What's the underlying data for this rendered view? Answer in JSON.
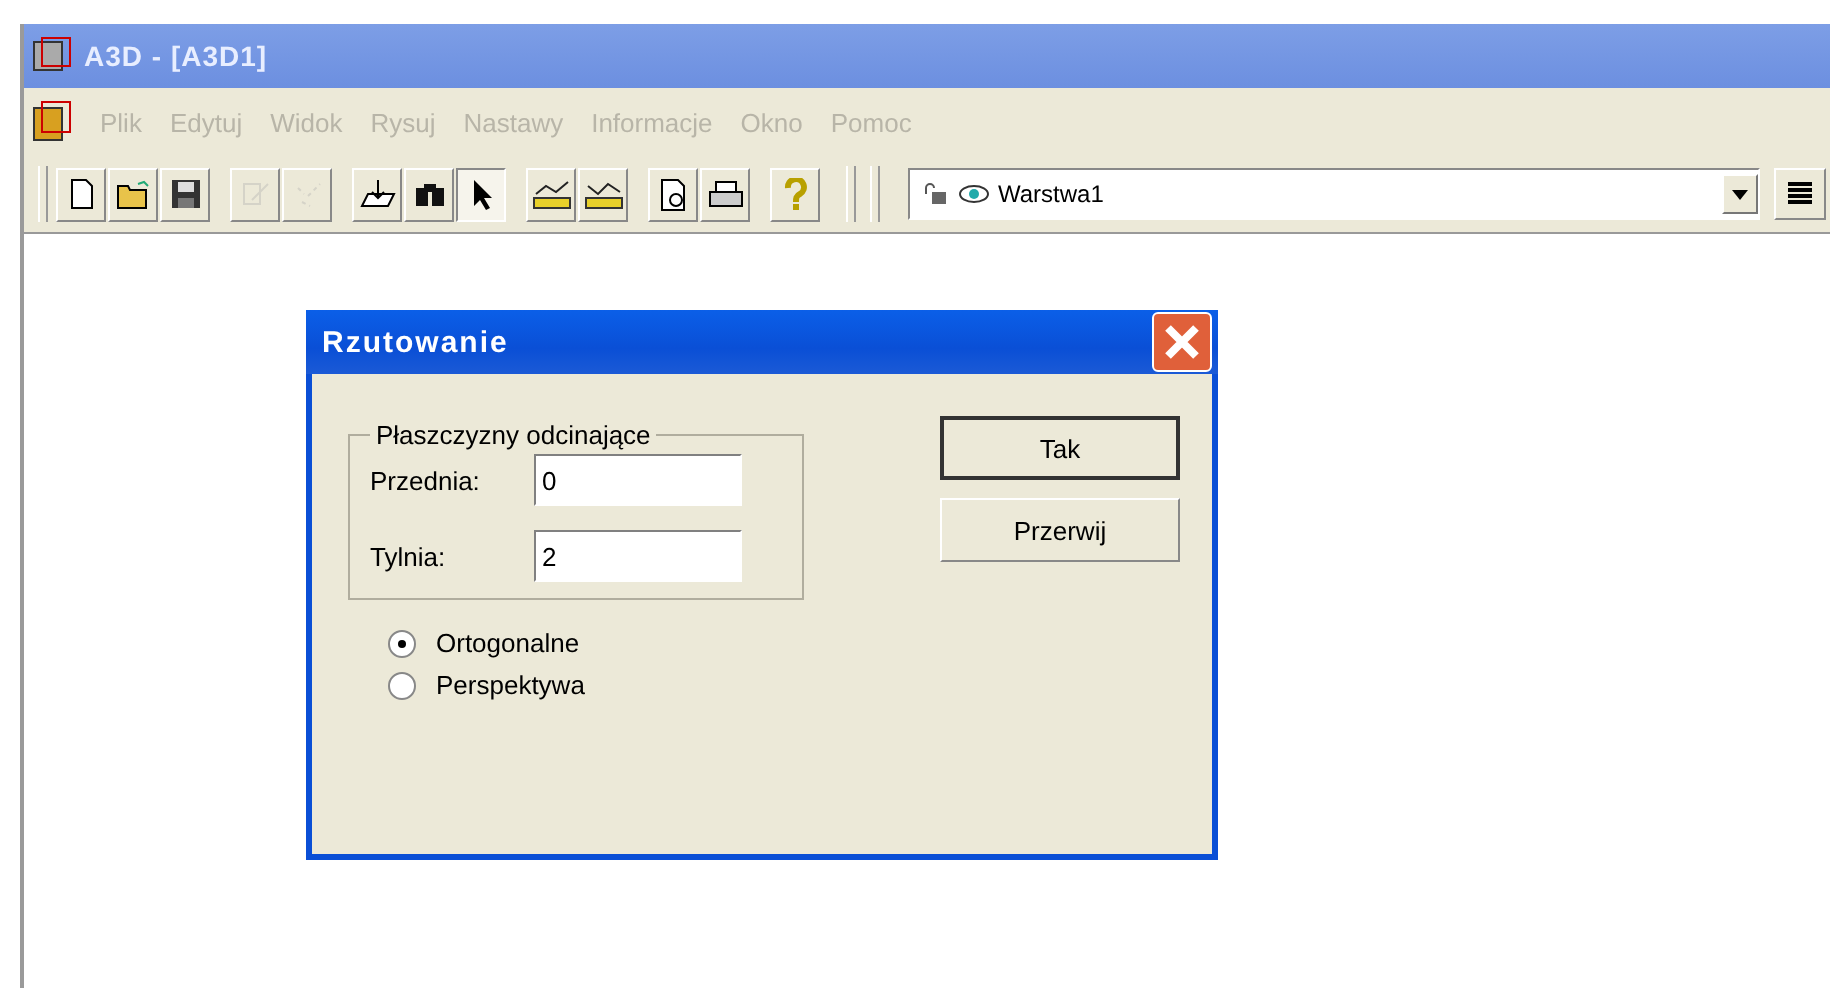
{
  "window": {
    "title": "A3D - [A3D1]"
  },
  "menu": [
    {
      "label": "Plik",
      "disabled": true
    },
    {
      "label": "Edytuj",
      "disabled": true
    },
    {
      "label": "Widok",
      "disabled": true
    },
    {
      "label": "Rysuj",
      "disabled": true
    },
    {
      "label": "Nastawy",
      "disabled": true
    },
    {
      "label": "Informacje",
      "disabled": true
    },
    {
      "label": "Okno",
      "disabled": true
    },
    {
      "label": "Pomoc",
      "disabled": true
    }
  ],
  "toolbar": [
    {
      "kind": "new",
      "disabled": false,
      "pressed": false
    },
    {
      "kind": "open",
      "disabled": false,
      "pressed": false
    },
    {
      "kind": "save",
      "disabled": false,
      "pressed": false
    },
    {
      "kind": "edit",
      "disabled": true,
      "pressed": false
    },
    {
      "kind": "edit2",
      "disabled": true,
      "pressed": false
    },
    {
      "kind": "plane",
      "disabled": false,
      "pressed": false
    },
    {
      "kind": "find",
      "disabled": false,
      "pressed": false
    },
    {
      "kind": "pointer",
      "disabled": false,
      "pressed": true
    },
    {
      "kind": "measure",
      "disabled": false,
      "pressed": false
    },
    {
      "kind": "measure2",
      "disabled": false,
      "pressed": false
    },
    {
      "kind": "preview",
      "disabled": false,
      "pressed": false
    },
    {
      "kind": "print",
      "disabled": false,
      "pressed": false
    },
    {
      "kind": "help",
      "disabled": false,
      "pressed": false
    }
  ],
  "layer": {
    "value": "Warstwa1"
  },
  "dialog": {
    "title": "Rzutowanie",
    "group_title": "Płaszczyzny odcinające",
    "fields": [
      {
        "label": "Przednia:",
        "value": "0"
      },
      {
        "label": "Tylnia:",
        "value": "2"
      }
    ],
    "buttons": [
      {
        "label": "Tak",
        "default": true
      },
      {
        "label": "Przerwij",
        "default": false
      }
    ],
    "radios": [
      {
        "label": "Ortogonalne",
        "selected": true
      },
      {
        "label": "Perspektywa",
        "selected": false
      }
    ]
  }
}
